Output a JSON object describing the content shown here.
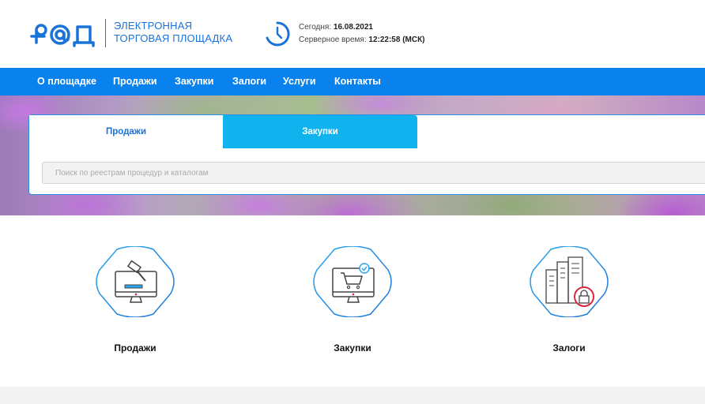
{
  "header": {
    "logo_alt": "РАД",
    "logo_text_line1": "ЭЛЕКТРОННАЯ",
    "logo_text_line2": "ТОРГОВАЯ ПЛОЩАДКА",
    "today_label": "Сегодня:",
    "today_value": "16.08.2021",
    "server_time_label": "Серверное время:",
    "server_time_value": "12:22:58 (МСК)"
  },
  "nav": {
    "items": [
      {
        "label": "О площадке"
      },
      {
        "label": "Продажи"
      },
      {
        "label": "Закупки"
      },
      {
        "label": "Залоги"
      },
      {
        "label": "Услуги"
      },
      {
        "label": "Контакты"
      }
    ]
  },
  "search": {
    "tabs": [
      {
        "label": "Продажи",
        "active": true
      },
      {
        "label": "Закупки",
        "active": false
      }
    ],
    "placeholder": "Поиск по реестрам процедур и каталогам"
  },
  "categories": [
    {
      "label": "Продажи",
      "icon": "auction-hammer-monitor-icon"
    },
    {
      "label": "Закупки",
      "icon": "shopping-cart-monitor-icon"
    },
    {
      "label": "Залоги",
      "icon": "building-lock-icon"
    }
  ],
  "colors": {
    "brand_blue": "#1a73d8",
    "nav_blue": "#0a82ee",
    "tab_cyan": "#10b3ee",
    "accent_red": "#d7263d"
  }
}
